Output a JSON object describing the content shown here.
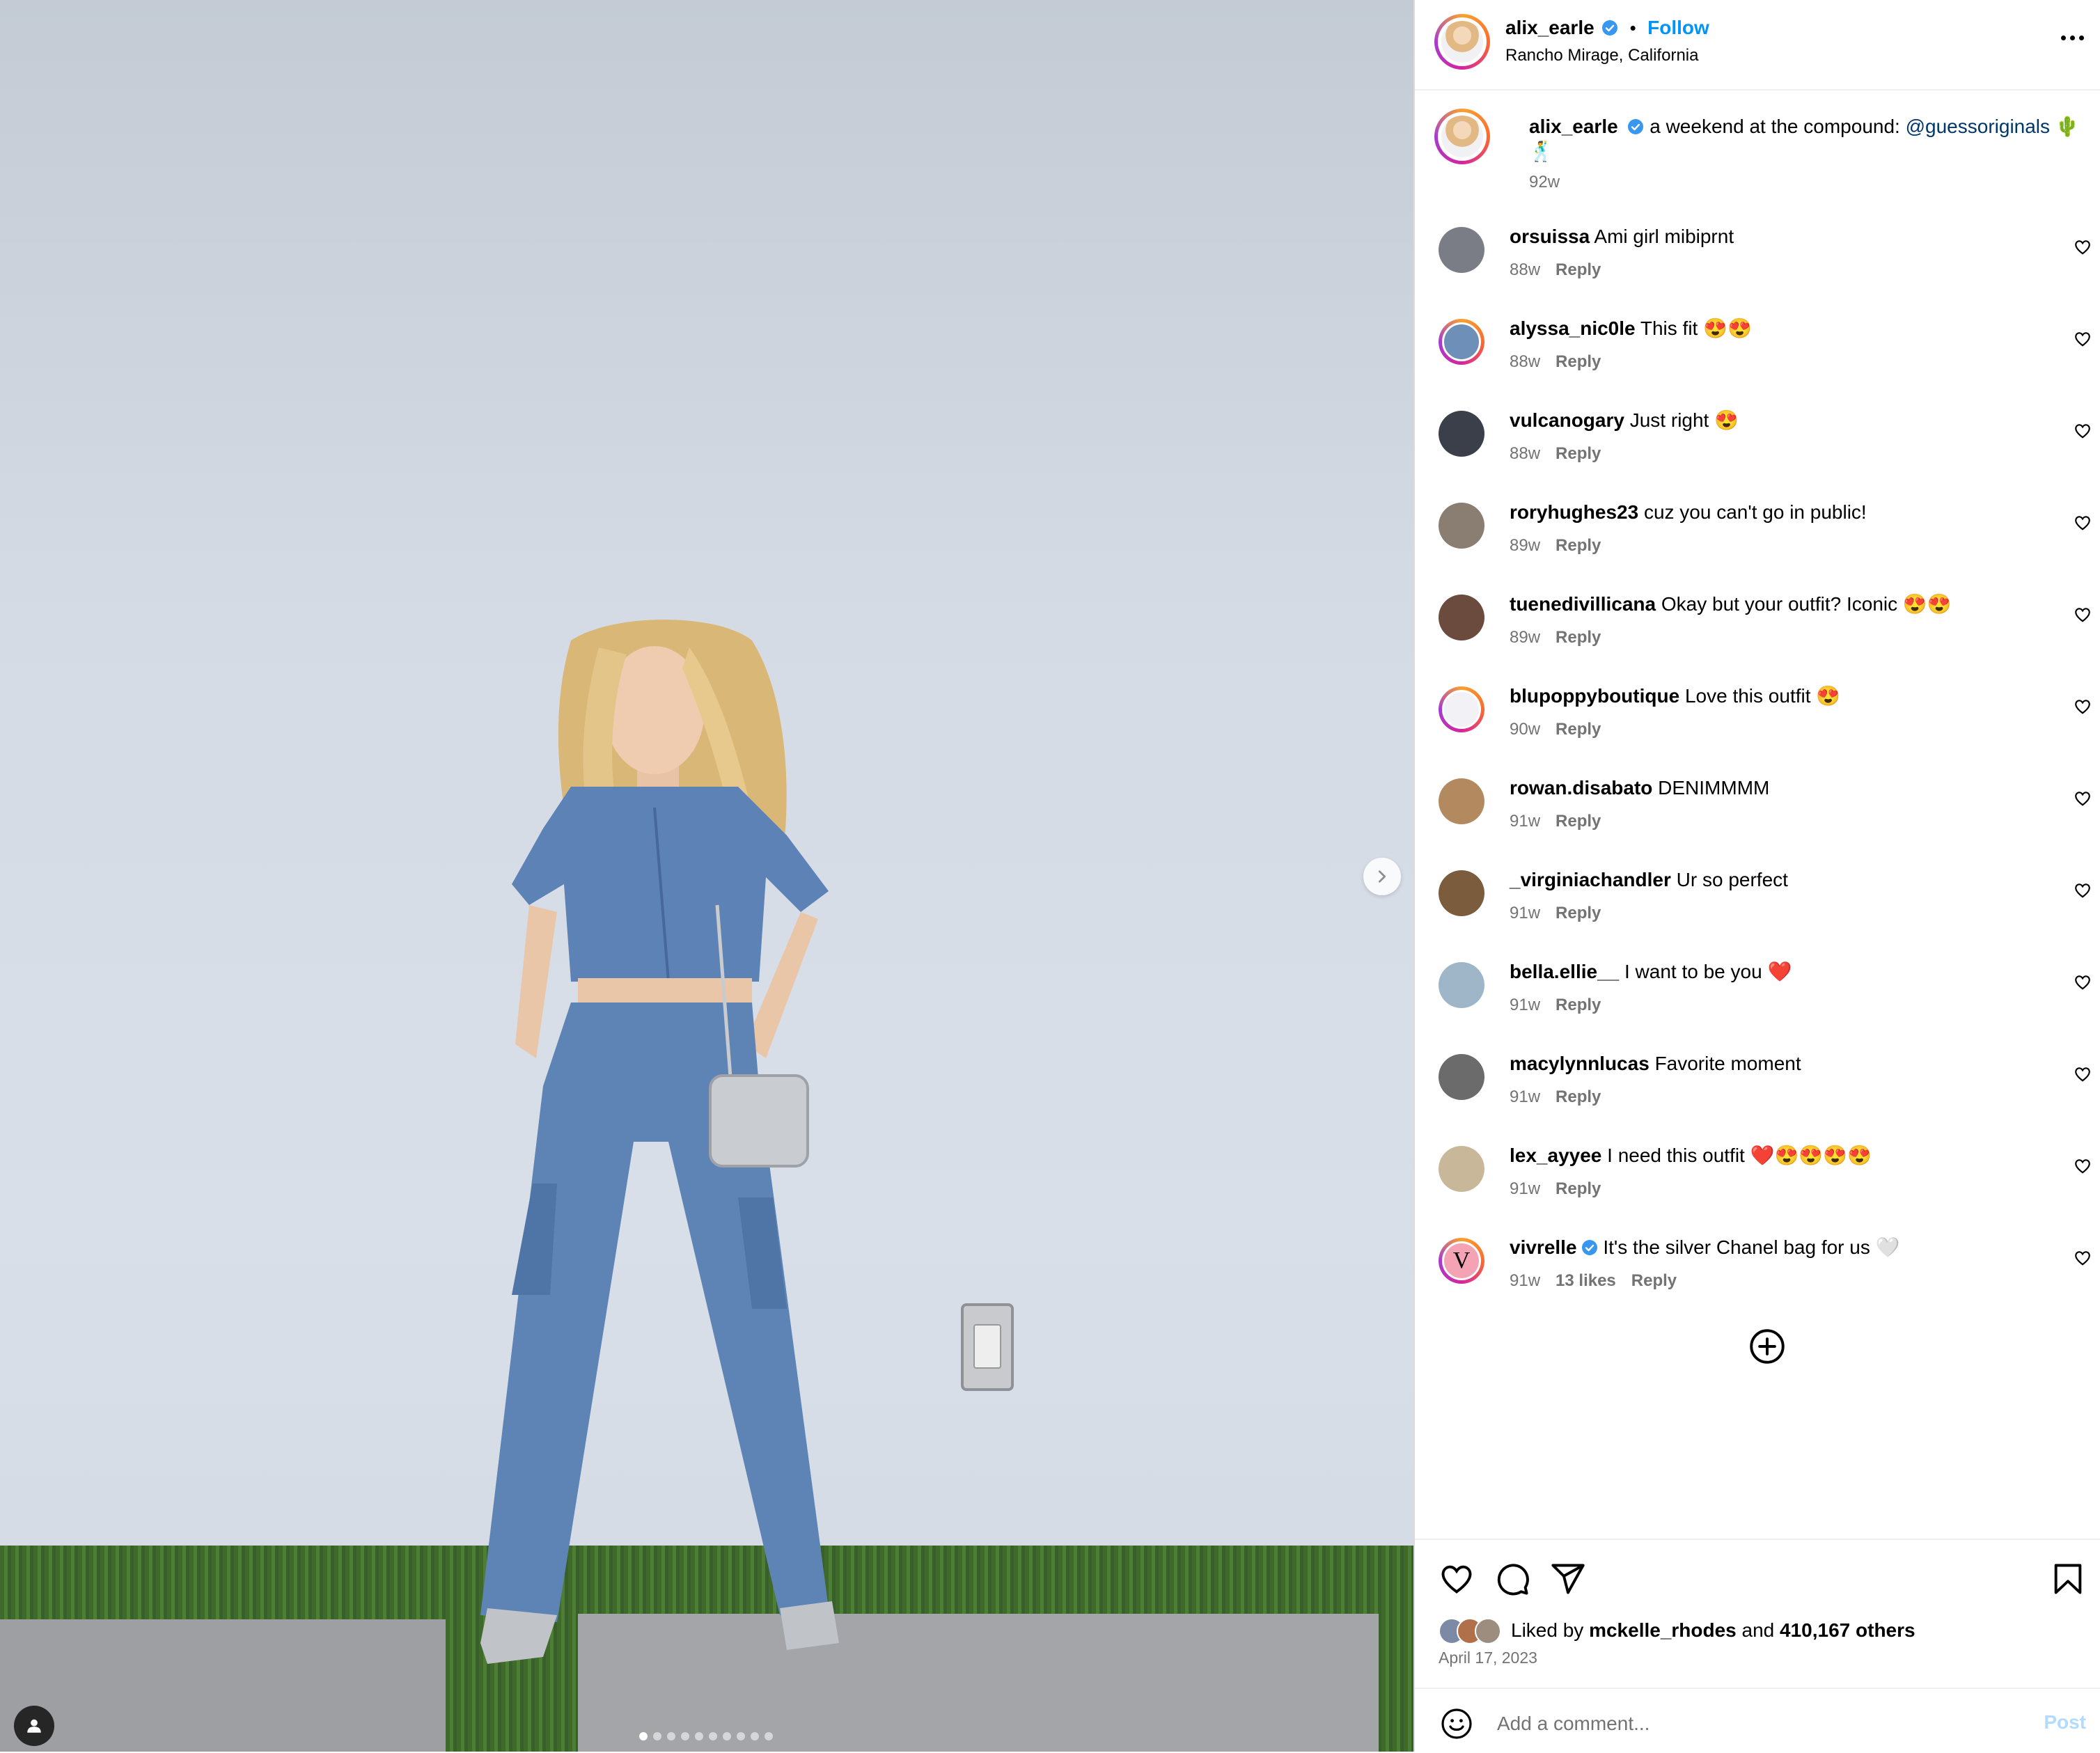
{
  "post": {
    "author": "alix_earle",
    "follow_label": "Follow",
    "location": "Rancho Mirage, California",
    "caption_text": "a weekend at the compound:",
    "caption_mention": "@guessoriginals",
    "caption_emoji": "🌵 🕺",
    "caption_time": "92w"
  },
  "media": {
    "slide_count": 10,
    "active_slide": 1
  },
  "comments": [
    {
      "user": "orsuissa",
      "text": "Ami girl mibiprnt",
      "time": "88w",
      "likes": "",
      "reply": "Reply",
      "avatar_color": "#7a7d86",
      "ring": false,
      "verified": false
    },
    {
      "user": "alyssa_nic0le",
      "text": "This fit 😍😍",
      "time": "88w",
      "likes": "",
      "reply": "Reply",
      "avatar_color": "#6e8fb8",
      "ring": true,
      "verified": false
    },
    {
      "user": "vulcanogary",
      "text": "Just right 😍",
      "time": "88w",
      "likes": "",
      "reply": "Reply",
      "avatar_color": "#3a3f4a",
      "ring": false,
      "verified": false
    },
    {
      "user": "roryhughes23",
      "text": "cuz you can't go in public!",
      "time": "89w",
      "likes": "",
      "reply": "Reply",
      "avatar_color": "#8a7d72",
      "ring": false,
      "verified": false
    },
    {
      "user": "tuenedivillicana",
      "text": "Okay but your outfit? Iconic 😍😍",
      "time": "89w",
      "likes": "",
      "reply": "Reply",
      "avatar_color": "#6b4b3e",
      "ring": false,
      "verified": false
    },
    {
      "user": "blupoppyboutique",
      "text": "Love this outfit 😍",
      "time": "90w",
      "likes": "",
      "reply": "Reply",
      "avatar_color": "#f2f2f6",
      "ring": true,
      "verified": false
    },
    {
      "user": "rowan.disabato",
      "text": "DENIMMMM",
      "time": "91w",
      "likes": "",
      "reply": "Reply",
      "avatar_color": "#b38a5f",
      "ring": false,
      "verified": false
    },
    {
      "user": "_virginiachandler",
      "text": "Ur so perfect",
      "time": "91w",
      "likes": "",
      "reply": "Reply",
      "avatar_color": "#7b5c3d",
      "ring": false,
      "verified": false
    },
    {
      "user": "bella.ellie__",
      "text": "I want to be you ❤️",
      "time": "91w",
      "likes": "",
      "reply": "Reply",
      "avatar_color": "#9eb6c8",
      "ring": false,
      "verified": false
    },
    {
      "user": "macylynnlucas",
      "text": "Favorite moment",
      "time": "91w",
      "likes": "",
      "reply": "Reply",
      "avatar_color": "#6b6b6b",
      "ring": false,
      "verified": false
    },
    {
      "user": "lex_ayyee",
      "text": "I need this outfit ❤️😍😍😍😍",
      "time": "91w",
      "likes": "",
      "reply": "Reply",
      "avatar_color": "#c9b79a",
      "ring": false,
      "verified": false
    },
    {
      "user": "vivrelle",
      "text": "It's the silver Chanel bag for us 🤍",
      "time": "91w",
      "likes": "13 likes",
      "reply": "Reply",
      "avatar_color": "#f4a3b4",
      "ring": true,
      "verified": true,
      "avatar_letter": "V"
    }
  ],
  "footer": {
    "liked_by_prefix": "Liked by",
    "liked_by_user": "mckelle_rhodes",
    "liked_by_and": "and",
    "liked_by_others": "410,167 others",
    "date": "April 17, 2023",
    "comment_placeholder": "Add a comment...",
    "post_label": "Post"
  },
  "colors": {
    "accent": "#0095f6",
    "verified": "#3897f0",
    "muted": "#737373",
    "mention": "#00376b"
  },
  "icons": [
    "heart-icon",
    "comment-icon",
    "share-icon",
    "bookmark-icon",
    "emoji-icon",
    "more-icon",
    "add-circle-icon",
    "chevron-right-icon",
    "user-tag-icon",
    "verified-icon"
  ]
}
